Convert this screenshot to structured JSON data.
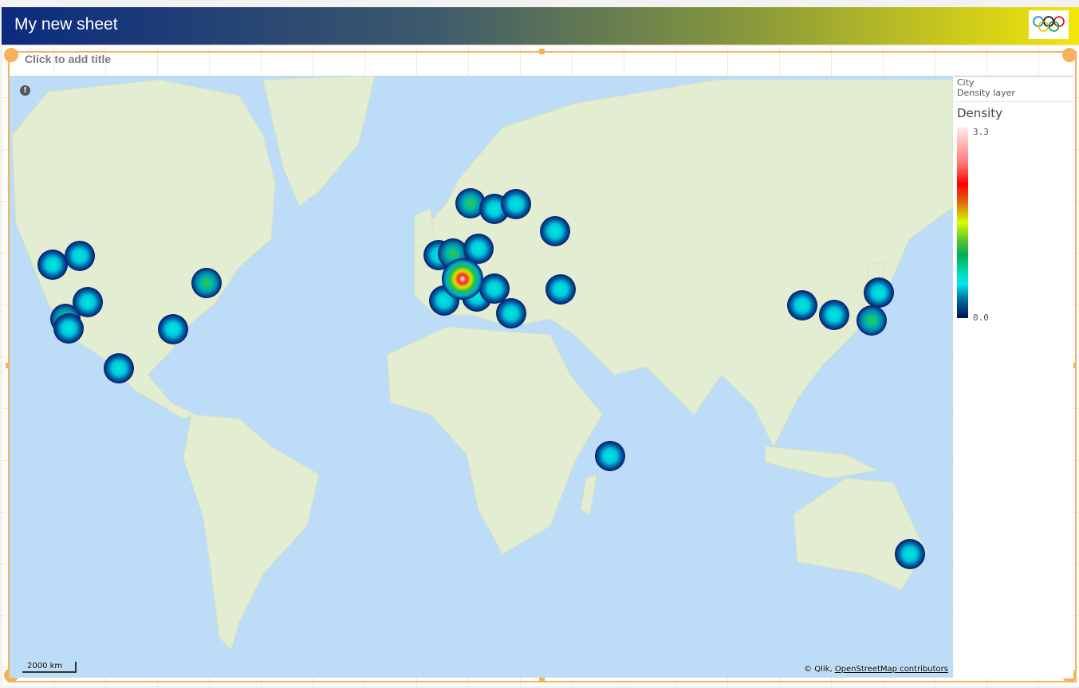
{
  "sheet": {
    "title": "My new sheet",
    "logo": "olympic-rings-logo"
  },
  "object": {
    "title_placeholder": "Click to add title"
  },
  "legend": {
    "dimension": "City",
    "layer": "Density layer",
    "title": "Density",
    "max_label": "3.3",
    "min_label": "0.0"
  },
  "map": {
    "scale_label": "2000 km",
    "attribution_prefix": "© Qlik, ",
    "attribution_link": "OpenStreetMap contributors",
    "warning_icon": "!"
  },
  "colors": {
    "frame": "#f6b15c",
    "ocean": "#bcdcf7",
    "land": "#e3edd2"
  }
}
